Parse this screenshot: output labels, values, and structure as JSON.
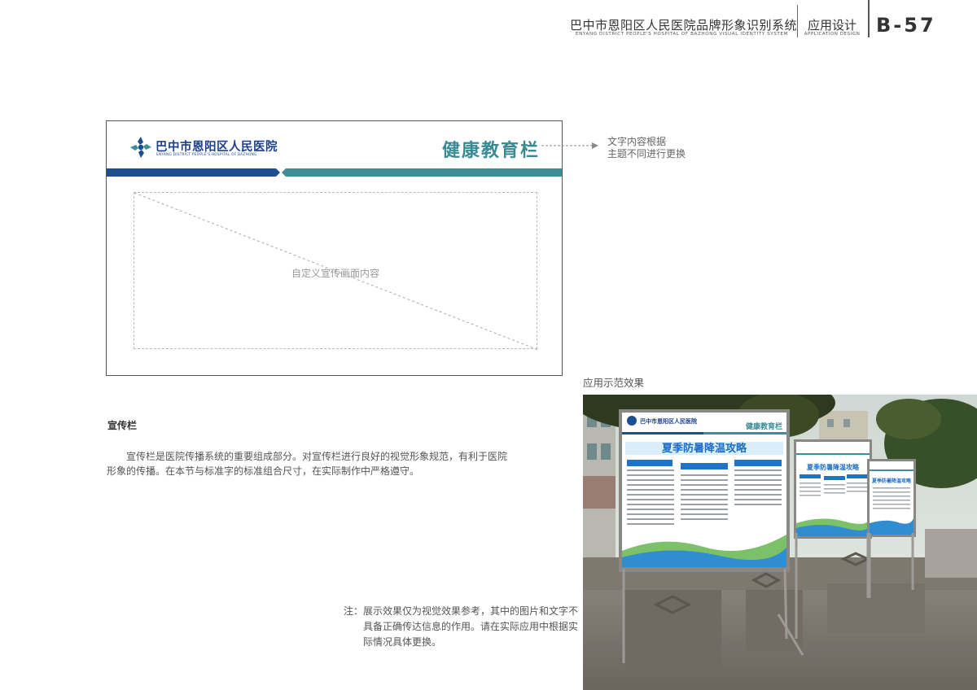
{
  "header": {
    "title": "巴中市恩阳区人民医院品牌形象识别系统",
    "subtitle": "ENYANG DISTRICT PEOPLE'S HOSPITAL OF BAZHONG VISUAL IDENTITY SYSTEM",
    "section": "应用设计",
    "section_en": "APPLICATION DESIGN",
    "page": "B-57"
  },
  "board": {
    "logo_cn": "巴中市恩阳区人民医院",
    "logo_en": "ENYANG DISTRICT PEOPLE'S HOSPITAL OF BAZHONG",
    "title": "健康教育栏",
    "placeholder": "自定义宣传画面内容",
    "colors": {
      "navy": "#1b4f8f",
      "teal": "#3d8f97"
    }
  },
  "annotation": {
    "line1": "文字内容根据",
    "line2": "主题不同进行更换"
  },
  "section": {
    "heading": "宣传栏",
    "body": "宣传栏是医院传播系统的重要组成部分。对宣传栏进行良好的视觉形象规范，有利于医院形象的传播。在本节与标准字的标准组合尺寸，在实际制作中严格遵守。"
  },
  "note": "注：展示效果仅为视觉效果参考，其中的图片和文字不具备正确传达信息的作用。请在实际应用中根据实际情况具体更换。",
  "photo": {
    "label": "应用示范效果",
    "panel_title": "健康教育栏",
    "panel_headline": "夏季防暑降温攻略",
    "panel_logo": "巴中市恩阳区人民医院"
  }
}
